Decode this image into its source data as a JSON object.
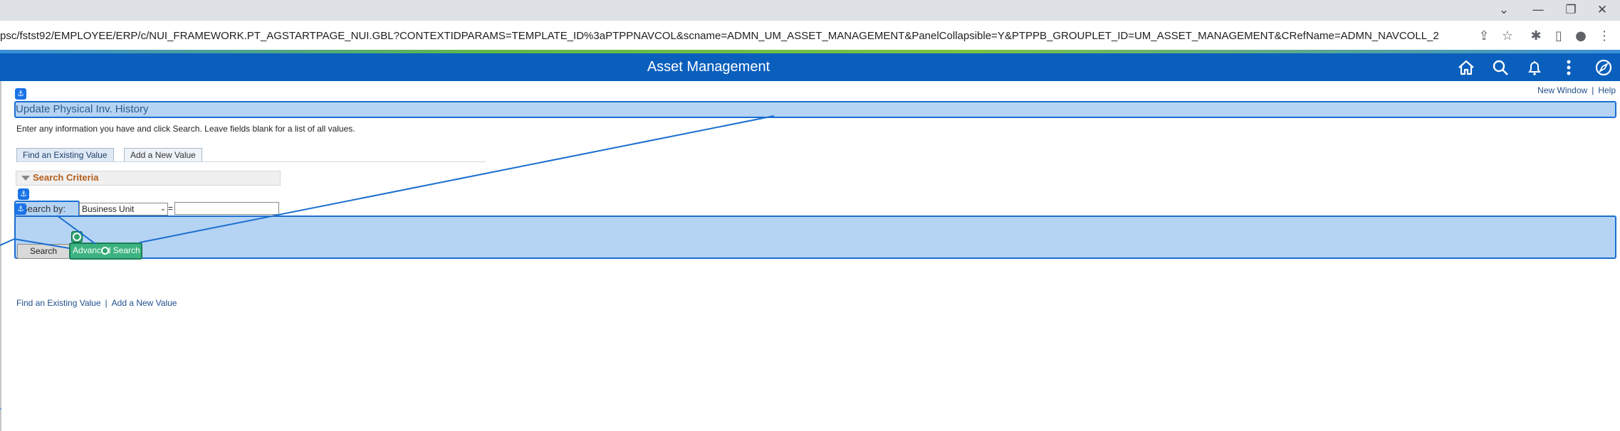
{
  "browser": {
    "url": "psc/fstst92/EMPLOYEE/ERP/c/NUI_FRAMEWORK.PT_AGSTARTPAGE_NUI.GBL?CONTEXTIDPARAMS=TEMPLATE_ID%3aPTPPNAVCOL&scname=ADMN_UM_ASSET_MANAGEMENT&PanelCollapsible=Y&PTPPB_GROUPLET_ID=UM_ASSET_MANAGEMENT&CRefName=ADMN_NAVCOLL_2",
    "window_controls": [
      "chevron-down-icon",
      "minimize-icon",
      "restore-icon",
      "close-icon"
    ],
    "toolbar_icons": [
      "share-icon",
      "star-icon",
      "extensions-icon",
      "sidepanel-icon",
      "profile-icon",
      "menu-icon"
    ]
  },
  "header": {
    "title": "Asset Management",
    "icons": [
      "home-icon",
      "search-icon",
      "bell-icon",
      "kebab-menu-icon",
      "navbar-compass-icon"
    ]
  },
  "top_links": {
    "new_window": "New Window",
    "separator": "|",
    "help": "Help"
  },
  "page": {
    "title": "Update Physical Inv. History",
    "instructions": "Enter any information you have and click Search. Leave fields blank for a list of all values.",
    "tabs": [
      {
        "label": "Find an Existing Value",
        "active": true
      },
      {
        "label": "Add a New Value",
        "active": false
      }
    ],
    "search_criteria": {
      "label": "Search Criteria"
    },
    "search_by": {
      "label": "Search by:",
      "selected": "Business Unit",
      "equals": "=",
      "value": ""
    },
    "buttons": {
      "search": "Search",
      "advanced_search": "Advanced Search"
    }
  },
  "bottom_links": {
    "find_existing": "Find an Existing Value",
    "separator": "|",
    "add_new": "Add a New Value"
  },
  "colors": {
    "header_blue": "#0a5fbd",
    "highlight_fill": "#b5d3f3",
    "highlight_border": "#1a6fd1",
    "green_highlight": "#3cb37f",
    "criteria_orange": "#b25d1b",
    "link_blue": "#1f4e8c"
  }
}
